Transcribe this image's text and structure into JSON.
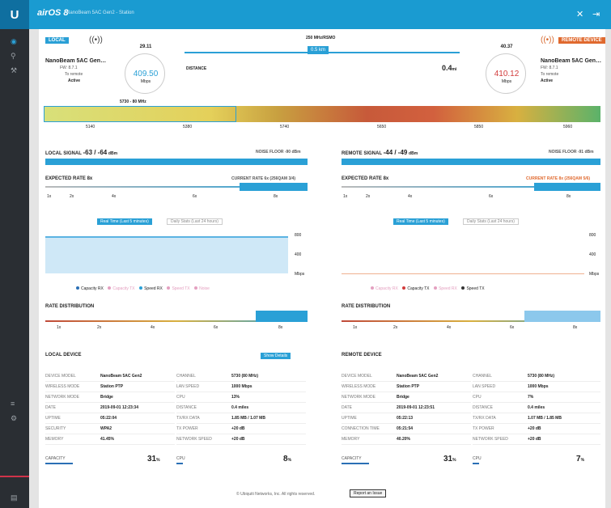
{
  "topbar": {
    "logo": "U",
    "brand": "airOS 8",
    "device_title": "NanoBeam 5AC Gen2 - Station"
  },
  "local": {
    "badge": "LOCAL",
    "name": "NanoBeam 5AC Gen…",
    "sub": "FW: 8.7.1",
    "role": "To remote",
    "status": "Active",
    "gauge_top": "29.11",
    "gauge_val": "409.50",
    "gauge_unit": "Mbps"
  },
  "remote": {
    "badge": "REMOTE DEVICE",
    "name": "NanoBeam 5AC Gen…",
    "sub": "FW: 8.7.1",
    "role": "To remote",
    "status": "Active",
    "gauge_top": "40.37",
    "gauge_val": "410.12",
    "gauge_unit": "Mbps"
  },
  "link": {
    "freq_label": "250 MHz/RSMO",
    "freq_value": "0.5 km",
    "distance_label": "DISTANCE",
    "distance_value": "0.4",
    "distance_unit": "mi"
  },
  "spectrum": {
    "label": "5730 - 80 MHz",
    "ticks": [
      "5140",
      "5380",
      "5740",
      "5650",
      "5850",
      "5960"
    ]
  },
  "signal_local": {
    "label": "LOCAL SIGNAL",
    "value": "-63 / -64",
    "unit": "dBm",
    "noise": "NOISE FLOOR -90 dBm",
    "level": 1.0
  },
  "signal_remote": {
    "label": "REMOTE SIGNAL",
    "value": "-44 / -49",
    "unit": "dBm",
    "noise": "NOISE FLOOR -91 dBm",
    "level": 1.0
  },
  "rate_local": {
    "label": "EXPECTED RATE 8x",
    "hint": "CURRENT RATE 6x (256QAM 3/4)",
    "ticks": [
      "1x",
      "2x",
      "4x",
      "6x",
      "8x"
    ]
  },
  "rate_remote": {
    "label": "EXPECTED RATE 8x",
    "hint": "CURRENT RATE 8x (256QAM 5/6)",
    "ticks": [
      "1x",
      "2x",
      "4x",
      "6x",
      "8x"
    ]
  },
  "chart_tabs": {
    "active": "Real Time (Last 5 minutes)",
    "inactive": "Daily Stats (Last 24 hours)"
  },
  "chart_local": {
    "y_ticks": [
      "800",
      "400",
      "Mbps"
    ],
    "legend": [
      "Capacity RX",
      "Capacity TX",
      "Speed RX",
      "Speed TX",
      "Noise"
    ]
  },
  "chart_remote": {
    "y_ticks": [
      "800",
      "400",
      "Mbps"
    ],
    "legend": [
      "Capacity RX",
      "Capacity TX",
      "Speed RX",
      "Speed TX"
    ]
  },
  "dist_local": {
    "label": "RATE DISTRIBUTION",
    "ticks": [
      "1x",
      "2x",
      "4x",
      "6x",
      "8x"
    ]
  },
  "dist_remote": {
    "label": "RATE DISTRIBUTION",
    "ticks": [
      "1x",
      "2x",
      "4x",
      "6x",
      "8x"
    ]
  },
  "local_device": {
    "title": "LOCAL DEVICE",
    "more_button": "Show Details",
    "rows_left": [
      [
        "DEVICE MODEL",
        "NanoBeam 5AC Gen2"
      ],
      [
        "WIRELESS MODE",
        "Station PTP"
      ],
      [
        "NETWORK MODE",
        "Bridge"
      ],
      [
        "DATE",
        "2019-09-01 12:23:34"
      ],
      [
        "UPTIME",
        "05:22:04"
      ],
      [
        "SECURITY",
        "WPA2"
      ],
      [
        "MEMORY",
        "41.45%"
      ]
    ],
    "rows_right": [
      [
        "CHANNEL",
        "5730 (80 MHz)"
      ],
      [
        "LAN SPEED",
        "1000 Mbps"
      ],
      [
        "CPU",
        "13%"
      ],
      [
        "DISTANCE",
        "0.4 miles"
      ],
      [
        "TX/RX DATA",
        "1.85 MB / 1.07 MB"
      ],
      [
        "TX POWER",
        "+20 dB"
      ],
      [
        "NETWORK SPEED",
        "+20 dB"
      ]
    ],
    "capacity_label": "CAPACITY",
    "capacity": "31",
    "capacity_unit": "%",
    "cpu_label": "CPU",
    "cpu": "8",
    "cpu_unit": "%"
  },
  "remote_device": {
    "title": "REMOTE DEVICE",
    "rows_left": [
      [
        "DEVICE MODEL",
        "NanoBeam 5AC Gen2"
      ],
      [
        "WIRELESS MODE",
        "Station PTP"
      ],
      [
        "NETWORK MODE",
        "Bridge"
      ],
      [
        "DATE",
        "2019-09-01 12:23:51"
      ],
      [
        "UPTIME",
        "05:22:13"
      ],
      [
        "CONNECTION TIME",
        "05:21:54"
      ],
      [
        "MEMORY",
        "40.20%"
      ]
    ],
    "rows_right": [
      [
        "CHANNEL",
        "5730 (80 MHz)"
      ],
      [
        "LAN SPEED",
        "1000 Mbps"
      ],
      [
        "CPU",
        "7%"
      ],
      [
        "DISTANCE",
        "0.4 miles"
      ],
      [
        "TX/RX DATA",
        "1.07 MB / 1.85 MB"
      ],
      [
        "TX POWER",
        "+20 dB"
      ],
      [
        "NETWORK SPEED",
        "+20 dB"
      ]
    ],
    "capacity_label": "CAPACITY",
    "capacity": "31",
    "capacity_unit": "%",
    "cpu_label": "CPU",
    "cpu": "7",
    "cpu_unit": "%"
  },
  "footer": {
    "text": "© Ubiquiti Networks, Inc. All rights reserved.",
    "button": "Report an Issue"
  }
}
